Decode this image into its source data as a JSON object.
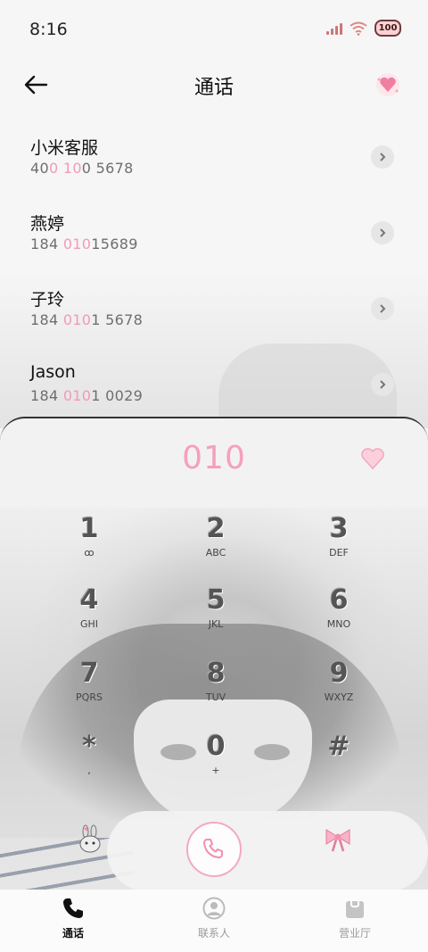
{
  "status_bar": {
    "time": "8:16",
    "battery": "100"
  },
  "header": {
    "title": "通话"
  },
  "contacts": [
    {
      "name": "小米客服",
      "number_parts": [
        "40",
        "0 10",
        "0 5678"
      ]
    },
    {
      "name": "燕婷",
      "number_parts": [
        "184 ",
        "010",
        "15689"
      ]
    },
    {
      "name": "子玲",
      "number_parts": [
        "184 ",
        "010",
        "1 5678"
      ]
    },
    {
      "name": "Jason",
      "number_parts": [
        "184 ",
        "010",
        "1 0029"
      ]
    }
  ],
  "dialer": {
    "typed_number": "010",
    "keys": [
      {
        "digit": "1",
        "letters": "ꝏ"
      },
      {
        "digit": "2",
        "letters": "ABC"
      },
      {
        "digit": "3",
        "letters": "DEF"
      },
      {
        "digit": "4",
        "letters": "GHI"
      },
      {
        "digit": "5",
        "letters": "JKL"
      },
      {
        "digit": "6",
        "letters": "MNO"
      },
      {
        "digit": "7",
        "letters": "PQRS"
      },
      {
        "digit": "8",
        "letters": "TUV"
      },
      {
        "digit": "9",
        "letters": "WXYZ"
      },
      {
        "digit": "*",
        "letters": ","
      },
      {
        "digit": "0",
        "letters": "+"
      },
      {
        "digit": "#",
        "letters": ""
      }
    ]
  },
  "bottom_nav": [
    {
      "label": "通话",
      "icon": "phone-icon",
      "active": true
    },
    {
      "label": "联系人",
      "icon": "person-icon",
      "active": false
    },
    {
      "label": "营业厅",
      "icon": "bag-icon",
      "active": false
    }
  ],
  "colors": {
    "accent_pink": "#f6a0ba",
    "highlight_pink": "#f29ab4"
  }
}
